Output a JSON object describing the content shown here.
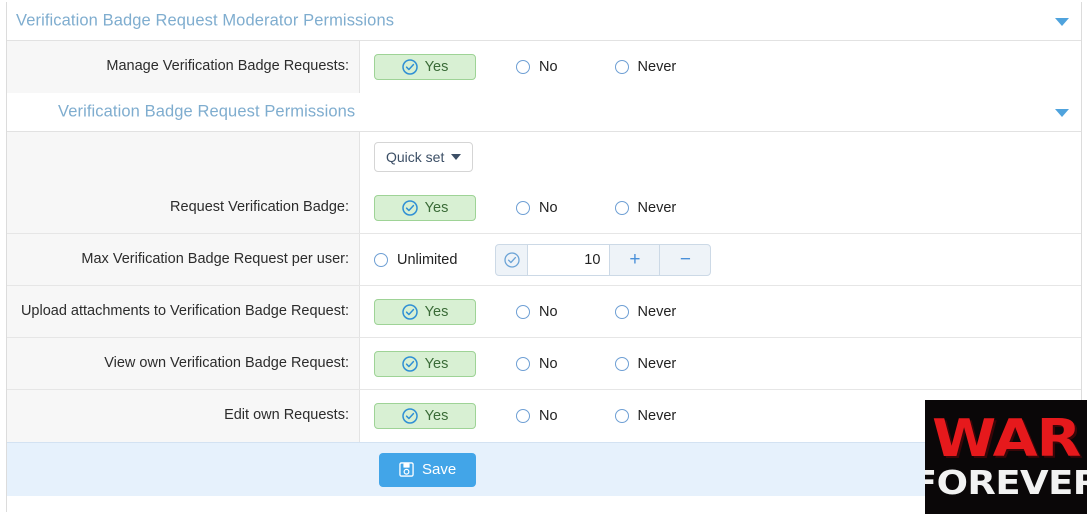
{
  "sections": [
    {
      "title": "Verification Badge Request Moderator Permissions",
      "caret_icon": "chevron-down-icon",
      "rows": [
        {
          "label": "Manage Verification Badge Requests:",
          "type": "tristate",
          "options": {
            "yes": "Yes",
            "no": "No",
            "never": "Never"
          },
          "selected": "yes"
        }
      ]
    },
    {
      "title": "Verification Badge Request Permissions",
      "caret_icon": "chevron-down-icon",
      "toolbar": {
        "quick_set_label": "Quick set",
        "quick_set_icon": "chevron-down-icon"
      },
      "rows": [
        {
          "label": "Request Verification Badge:",
          "type": "tristate",
          "options": {
            "yes": "Yes",
            "no": "No",
            "never": "Never"
          },
          "selected": "yes"
        },
        {
          "label": "Max Verification Badge Request per user:",
          "type": "number",
          "unlimited_label": "Unlimited",
          "value": "10",
          "increment_label": "+",
          "decrement_label": "−",
          "check_icon": "check-circle-icon",
          "selected": "number"
        },
        {
          "label": "Upload attachments to Verification Badge Request:",
          "type": "tristate",
          "options": {
            "yes": "Yes",
            "no": "No",
            "never": "Never"
          },
          "selected": "yes"
        },
        {
          "label": "View own Verification Badge Request:",
          "type": "tristate",
          "options": {
            "yes": "Yes",
            "no": "No",
            "never": "Never"
          },
          "selected": "yes"
        },
        {
          "label": "Edit own Requests:",
          "type": "tristate",
          "options": {
            "yes": "Yes",
            "no": "No",
            "never": "Never"
          },
          "selected": "yes"
        }
      ]
    }
  ],
  "footer": {
    "save_label": "Save",
    "save_icon": "floppy-disk-icon"
  },
  "watermark": {
    "line1": "WAR",
    "line2": "FOREVER"
  },
  "colors": {
    "header_text": "#7fadcf",
    "caret": "#4fa3dd",
    "yes_bg": "#d8f0d3",
    "yes_border": "#9ed396",
    "yes_text": "#3a6b37",
    "radio_border": "#6e9fd4",
    "save_bg": "#42a5e8",
    "footer_bg": "#e6f1fc",
    "row_label_bg": "#f7f7f7",
    "watermark_red": "#e6191c",
    "watermark_bg": "#0a0708"
  }
}
